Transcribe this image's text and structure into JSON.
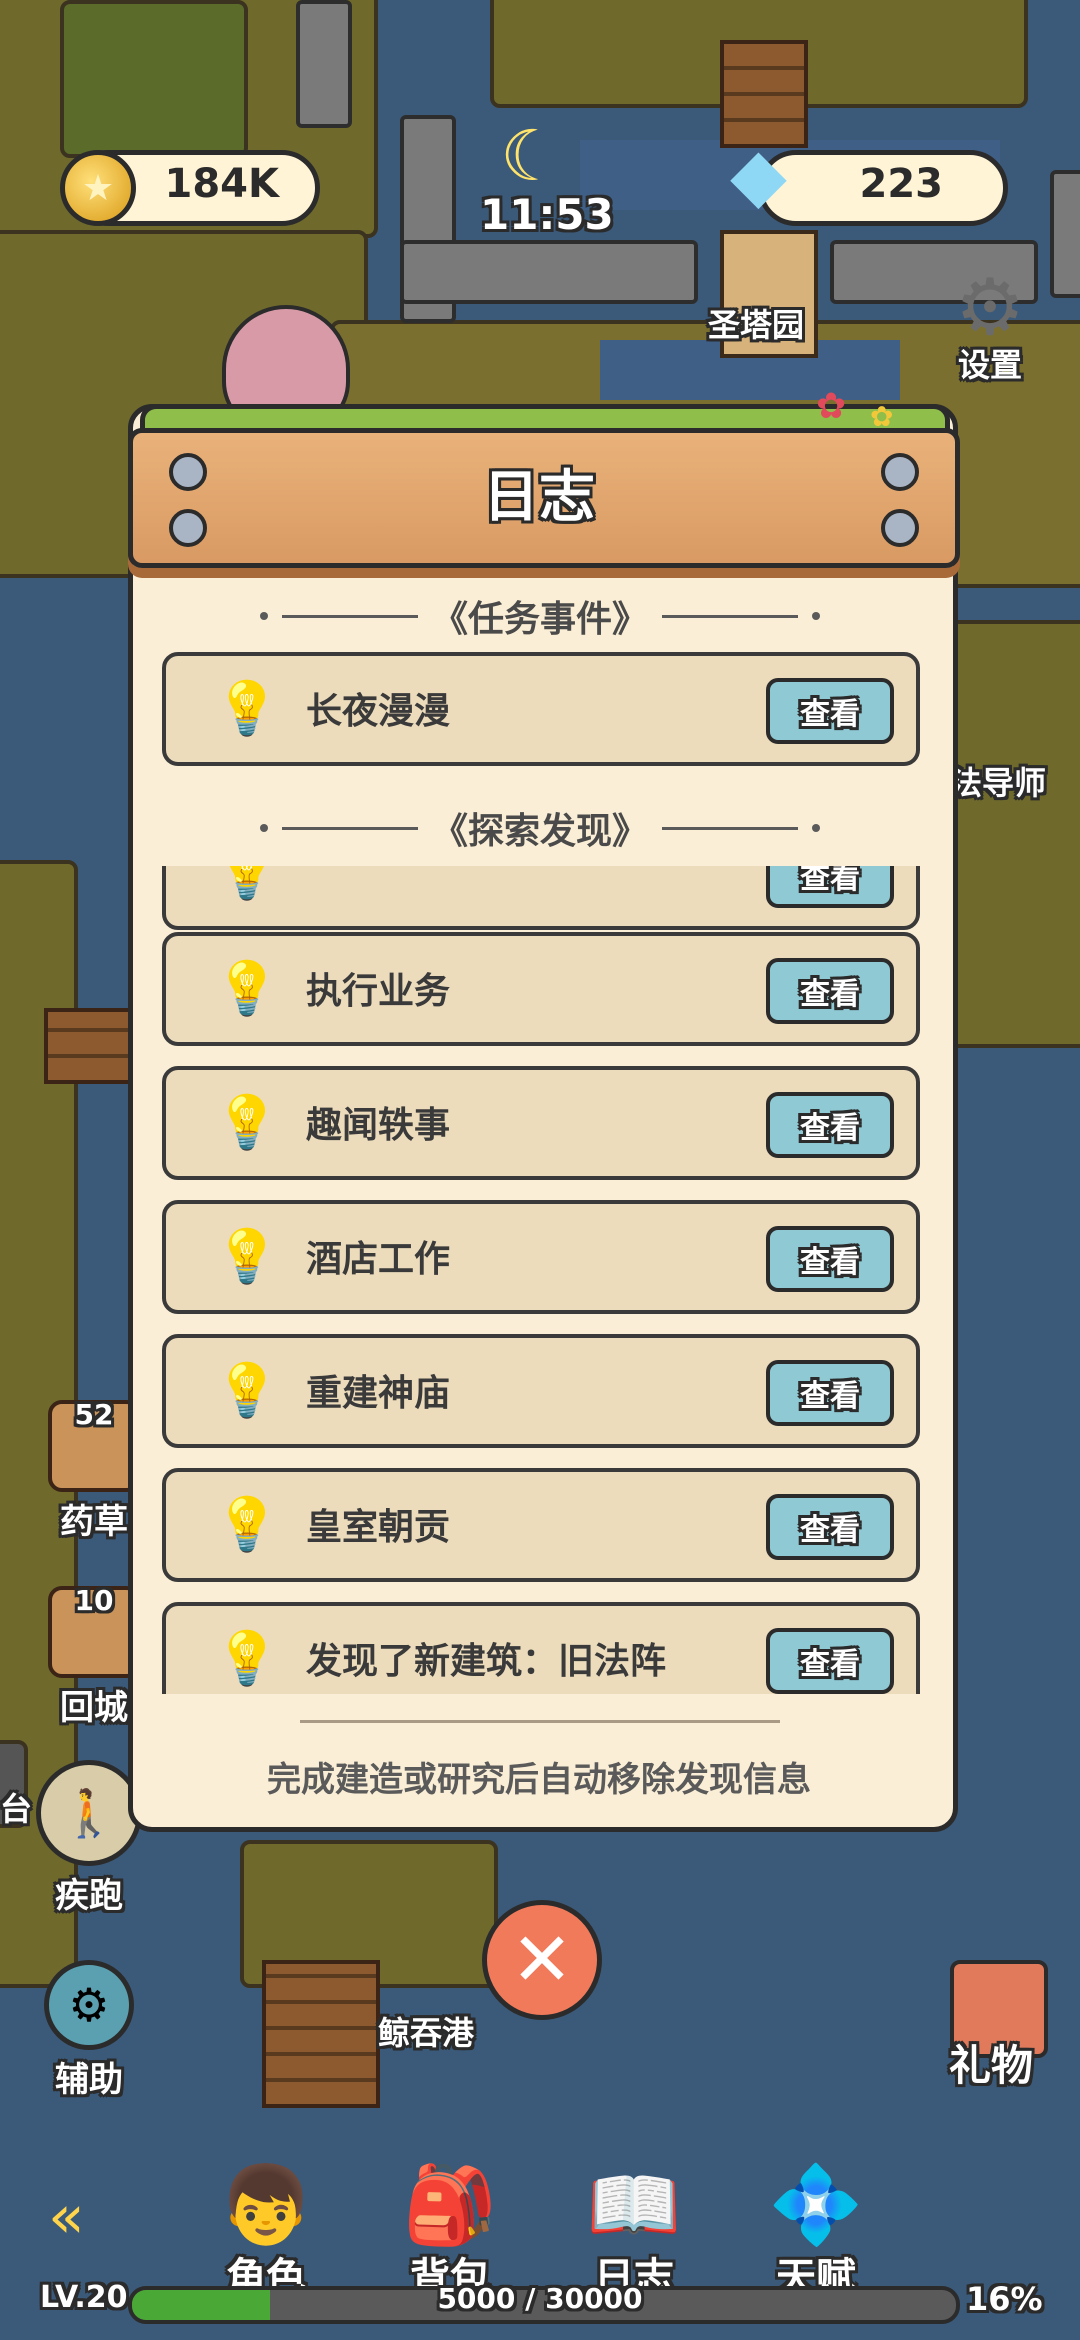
{
  "hud": {
    "gold": "184K",
    "gems": "223",
    "time": "11:53",
    "settings_label": "设置"
  },
  "map_labels": {
    "holy_garden": "圣塔园",
    "mage_mentor": "法导师",
    "whale_port": "鲸吞港",
    "left_edge": "台"
  },
  "side_buttons": {
    "herb": {
      "count": "52",
      "label": "药草"
    },
    "return_city": {
      "count": "10",
      "label": "回城"
    },
    "sprint": {
      "label": "疾跑"
    },
    "assist": {
      "label": "辅助"
    },
    "gift": {
      "label": "礼物"
    }
  },
  "dialog": {
    "title": "日志",
    "section_tasks": "任务事件",
    "section_explore": "探索发现",
    "task_items": [
      {
        "name": "长夜漫漫",
        "action": "查看"
      }
    ],
    "explore_items": [
      {
        "name": "",
        "action": "查看"
      },
      {
        "name": "执行业务",
        "action": "查看"
      },
      {
        "name": "趣闻轶事",
        "action": "查看"
      },
      {
        "name": "酒店工作",
        "action": "查看"
      },
      {
        "name": "重建神庙",
        "action": "查看"
      },
      {
        "name": "皇室朝贡",
        "action": "查看"
      },
      {
        "name": "发现了新建筑：旧法阵",
        "action": "查看"
      }
    ],
    "footer": "完成建造或研究后自动移除发现信息"
  },
  "bottom_nav": {
    "character": "角色",
    "backpack": "背包",
    "journal": "日志",
    "talent": "天赋"
  },
  "level": {
    "label": "LV.20",
    "xp_text": "5000 / 30000",
    "progress": 0.167,
    "percent": "16%"
  },
  "colors": {
    "dialog_bg": "#fbeed6",
    "card_bg": "#ecdcbc",
    "view_button": "#8ec9d4",
    "header_wood": "#e2a86f",
    "close_button": "#f07a5a",
    "xp_fill": "#4aa836"
  },
  "icons": {
    "currency": "gold-coin-icon",
    "premium": "diamond-icon",
    "night": "moon-icon",
    "settings": "gear-icon",
    "entry": "lightbulb-icon",
    "close": "close-icon",
    "back": "double-chevron-left-icon"
  }
}
